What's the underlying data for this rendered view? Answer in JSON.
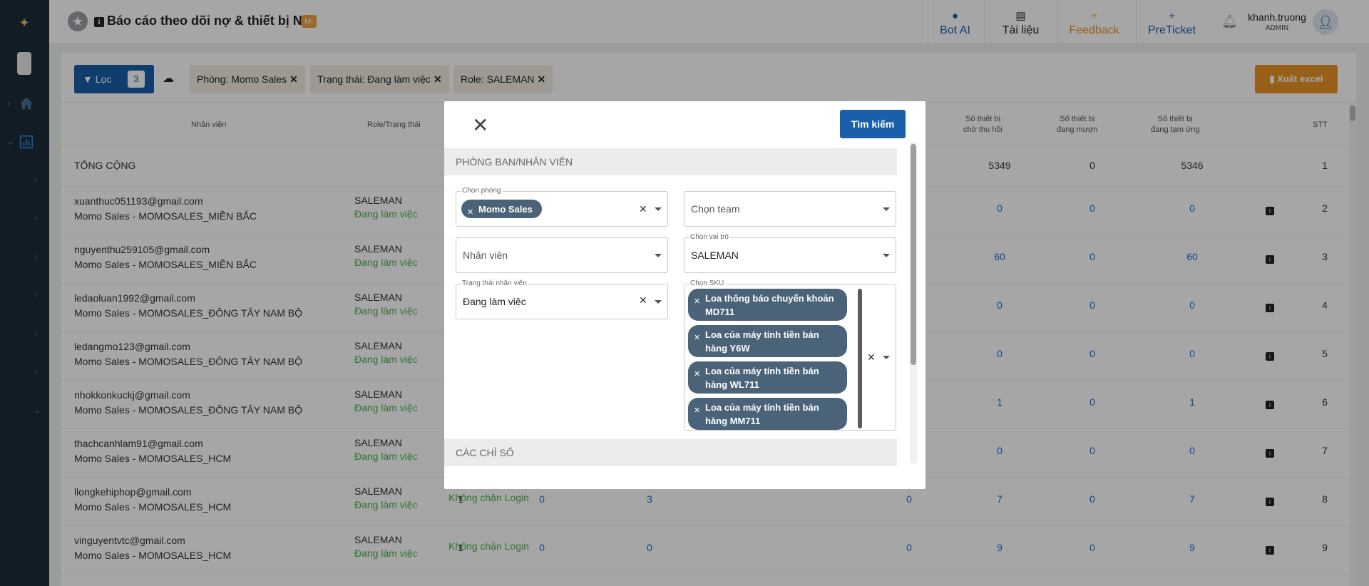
{
  "header": {
    "title": "Báo cáo theo dõi nợ & thiết bị NV",
    "badge": "M-",
    "buttons": [
      {
        "icon": "chat-icon",
        "label": "Bot AI",
        "color": "#1b5faa"
      },
      {
        "icon": "book-icon",
        "label": "Tài liệu",
        "color": "#222222"
      },
      {
        "icon": "plus-icon",
        "label": "Feedback",
        "color": "#e89325"
      },
      {
        "icon": "plus-icon",
        "label": "PreTicket",
        "color": "#1b5faa"
      }
    ],
    "user_name": "khanh.truong",
    "user_role": "ADMIN"
  },
  "toolbar": {
    "filter_label": "Lọc",
    "filter_count": "3",
    "chips": [
      "Phòng: Momo Sales",
      "Trạng thái: Đang làm việc",
      "Role: SALEMAN"
    ],
    "export_label": "Xuất excel"
  },
  "table": {
    "headers": {
      "employee": "Nhân viên",
      "role_status": "Role/Trạng thái",
      "devices_pending_l1": "Số thiết bị",
      "devices_pending_l2": "chờ thu hồi",
      "devices_borrowed_l1": "Số thiết bị",
      "devices_borrowed_l2": "đang mượn",
      "devices_advance_l1": "Số thiết bị",
      "devices_advance_l2": "đang tạm ứng",
      "stt": "STT"
    },
    "total": {
      "label": "TỔNG CỘNG",
      "pending": "5349",
      "borrowed": "0",
      "advance": "5346",
      "stt": "1"
    },
    "rows": [
      {
        "email": "xuanthuc051193@gmail.com",
        "dept": "Momo Sales - MOMOSALES_MIỀN BẮC",
        "role": "SALEMAN",
        "status": "Đang làm việc",
        "login": "",
        "c1": "",
        "c2": "",
        "c3": "",
        "c4": "",
        "pending": "0",
        "borrowed": "0",
        "advance": "0",
        "stt": "2"
      },
      {
        "email": "nguyenthu259105@gmail.com",
        "dept": "Momo Sales - MOMOSALES_MIỀN BẮC",
        "role": "SALEMAN",
        "status": "Đang làm việc",
        "login": "",
        "c1": "",
        "c2": "",
        "c3": "",
        "c4": "",
        "pending": "60",
        "borrowed": "0",
        "advance": "60",
        "stt": "3"
      },
      {
        "email": "ledaoluan1992@gmail.com",
        "dept": "Momo Sales - MOMOSALES_ĐÔNG TÂY NAM BỘ",
        "role": "SALEMAN",
        "status": "Đang làm việc",
        "login": "",
        "c1": "",
        "c2": "",
        "c3": "",
        "c4": "",
        "pending": "0",
        "borrowed": "0",
        "advance": "0",
        "stt": "4"
      },
      {
        "email": "ledangmo123@gmail.com",
        "dept": "Momo Sales - MOMOSALES_ĐÔNG TÂY NAM BỘ",
        "role": "SALEMAN",
        "status": "Đang làm việc",
        "login": "",
        "c1": "",
        "c2": "",
        "c3": "",
        "c4": "",
        "pending": "0",
        "borrowed": "0",
        "advance": "0",
        "stt": "5"
      },
      {
        "email": "nhokkonkuckj@gmail.com",
        "dept": "Momo Sales - MOMOSALES_ĐÔNG TÂY NAM BỘ",
        "role": "SALEMAN",
        "status": "Đang làm việc",
        "login": "",
        "c1": "",
        "c2": "",
        "c3": "",
        "c4": "",
        "pending": "1",
        "borrowed": "0",
        "advance": "1",
        "stt": "6"
      },
      {
        "email": "thachcanhlam91@gmail.com",
        "dept": "Momo Sales - MOMOSALES_HCM",
        "role": "SALEMAN",
        "status": "Đang làm việc",
        "login": "",
        "c1": "",
        "c2": "",
        "c3": "",
        "c4": "",
        "pending": "0",
        "borrowed": "0",
        "advance": "0",
        "stt": "7"
      },
      {
        "email": "llongkehiphop@gmail.com",
        "dept": "Momo Sales - MOMOSALES_HCM",
        "role": "SALEMAN",
        "status": "Đang làm việc",
        "login": "Không chặn Login",
        "c1": "1",
        "c2": "0",
        "c3": "3",
        "c4": "0",
        "pending": "7",
        "borrowed": "0",
        "advance": "7",
        "stt": "8"
      },
      {
        "email": "vinguyentvtc@gmail.com",
        "dept": "Momo Sales - MOMOSALES_HCM",
        "role": "SALEMAN",
        "status": "Đang làm việc",
        "login": "Không chặn Login",
        "c1": "1",
        "c2": "0",
        "c3": "0",
        "c4": "0",
        "pending": "9",
        "borrowed": "0",
        "advance": "9",
        "stt": "9"
      }
    ]
  },
  "modal": {
    "search_label": "Tìm kiếm",
    "section1": "PHÒNG BAN/NHÂN VIÊN",
    "section2": "CÁC CHỈ SỐ",
    "dept": {
      "label": "Chọn phòng",
      "value": "Momo Sales"
    },
    "team": {
      "placeholder": "Chọn team"
    },
    "employee": {
      "placeholder": "Nhân viên"
    },
    "role": {
      "label": "Chọn vai trò",
      "value": "SALEMAN"
    },
    "status": {
      "label": "Trạng thái nhân viên",
      "value": "Đang làm việc"
    },
    "sku": {
      "label": "Chọn SKU",
      "items": [
        {
          "l1": "Loa thông báo chuyển khoản",
          "l2": "MD711"
        },
        {
          "l1": "Loa của máy tính tiền bán",
          "l2": "hàng Y6W"
        },
        {
          "l1": "Loa của máy tính tiền bán",
          "l2": "hàng WL711"
        },
        {
          "l1": "Loa của máy tính tiền bán",
          "l2": "hàng MM711"
        }
      ]
    }
  }
}
